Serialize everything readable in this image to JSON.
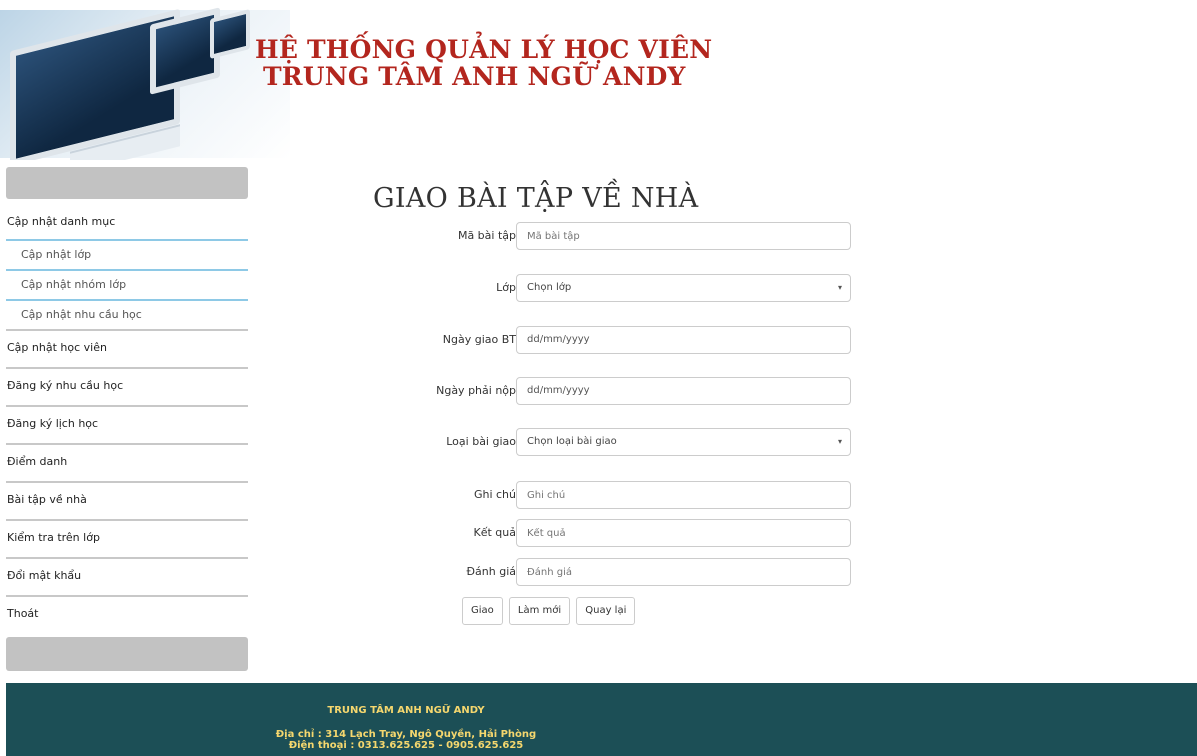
{
  "header": {
    "title_line1": "HỆ THỐNG QUẢN LÝ HỌC VIÊN",
    "title_line2": "TRUNG TÂM ANH NGỮ ANDY"
  },
  "sidebar": {
    "items": [
      {
        "label": "Cập nhật danh mục"
      },
      {
        "label": "Cập nhật lớp"
      },
      {
        "label": "Cập nhật nhóm lớp"
      },
      {
        "label": "Cập nhật nhu cầu học"
      },
      {
        "label": "Cập nhật học viên"
      },
      {
        "label": "Đăng ký nhu cầu học"
      },
      {
        "label": "Đăng ký lịch học"
      },
      {
        "label": "Điểm danh"
      },
      {
        "label": "Bài tập về nhà"
      },
      {
        "label": "Kiểm tra trên lớp"
      },
      {
        "label": "Đổi mật khẩu"
      },
      {
        "label": "Thoát"
      }
    ]
  },
  "form": {
    "title": "GIAO BÀI TẬP VỀ NHÀ",
    "fields": {
      "ma_bai_tap": {
        "label": "Mã bài tập",
        "placeholder": "Mã bài tập"
      },
      "lop": {
        "label": "Lớp",
        "selected": "Chọn lớp"
      },
      "ngay_giao": {
        "label": "Ngày giao BT",
        "value": "dd/mm/yyyy"
      },
      "ngay_nop": {
        "label": "Ngày phải nộp",
        "value": "dd/mm/yyyy"
      },
      "loai_bai": {
        "label": "Loại bài giao",
        "selected": "Chọn loại bài giao"
      },
      "ghi_chu": {
        "label": "Ghi chú",
        "placeholder": "Ghi chú"
      },
      "ket_qua": {
        "label": "Kết quả",
        "placeholder": "Kết quả"
      },
      "danh_gia": {
        "label": "Đánh giá",
        "placeholder": "Đánh giá"
      }
    },
    "buttons": {
      "submit": "Giao",
      "reset": "Làm mới",
      "back": "Quay lại"
    }
  },
  "footer": {
    "org": "TRUNG TÂM ANH NGỮ ANDY",
    "address": "Địa chỉ : 314 Lạch Tray, Ngô Quyền, Hải Phòng",
    "phone": "Điện thoại : 0313.625.625 - 0905.625.625"
  }
}
